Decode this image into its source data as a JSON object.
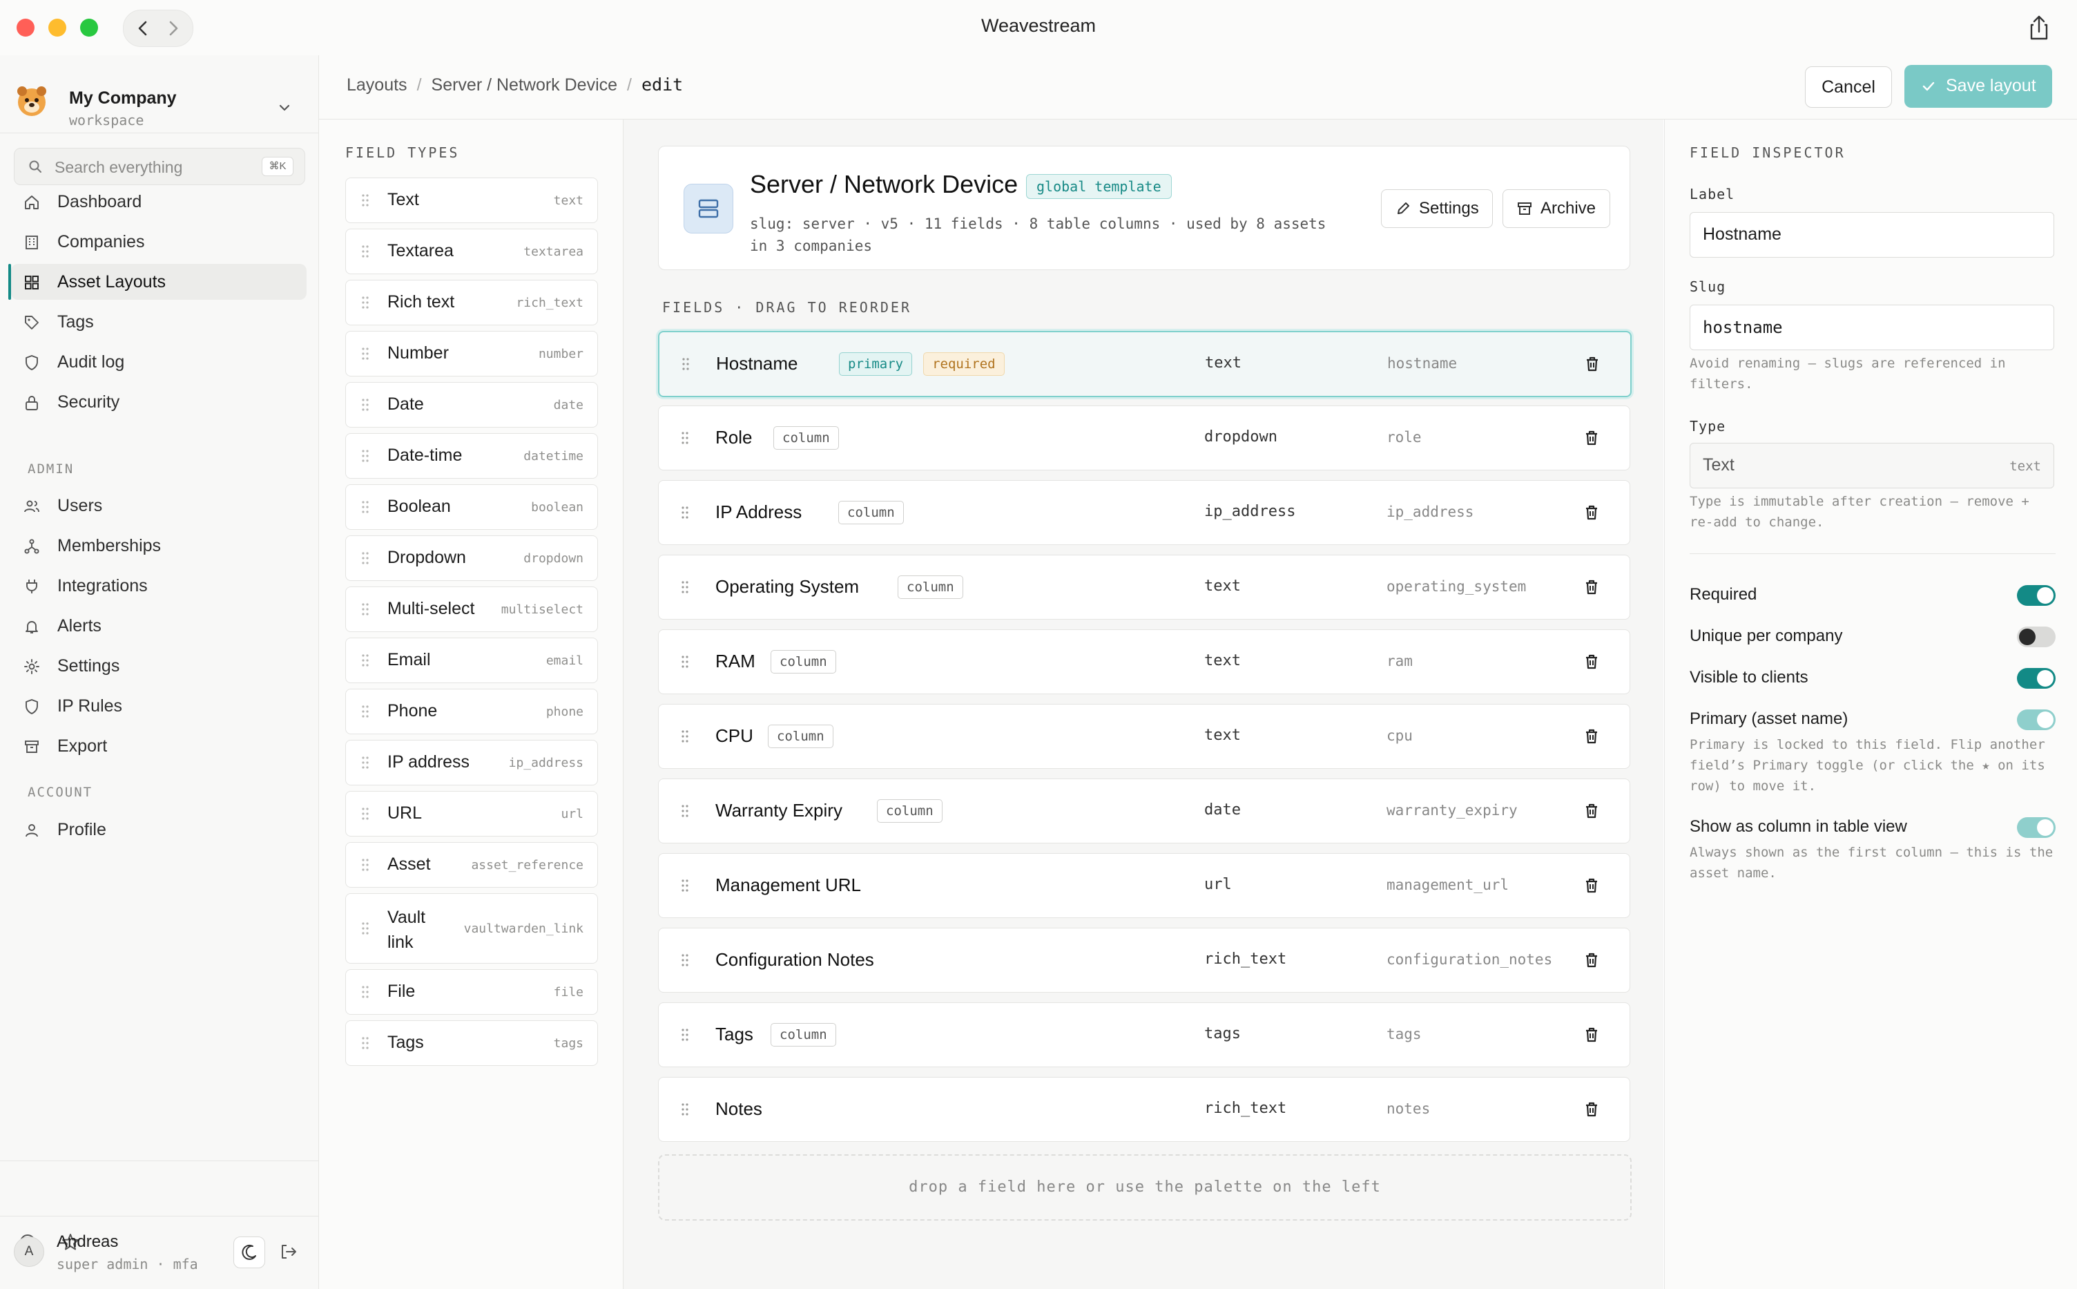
{
  "window": {
    "title": "Weavestream"
  },
  "workspace": {
    "name": "My Company",
    "type": "workspace"
  },
  "search": {
    "placeholder": "Search everything",
    "shortcut": "⌘K"
  },
  "nav": {
    "main": [
      {
        "label": "Dashboard",
        "icon": "home-icon"
      },
      {
        "label": "Companies",
        "icon": "building-icon"
      },
      {
        "label": "Asset Layouts",
        "icon": "grid-icon",
        "active": true
      },
      {
        "label": "Tags",
        "icon": "tag-icon"
      },
      {
        "label": "Audit log",
        "icon": "shield-icon"
      },
      {
        "label": "Security",
        "icon": "lock-icon"
      }
    ],
    "admin_label": "ADMIN",
    "admin": [
      {
        "label": "Users",
        "icon": "users-icon"
      },
      {
        "label": "Memberships",
        "icon": "network-icon"
      },
      {
        "label": "Integrations",
        "icon": "plug-icon"
      },
      {
        "label": "Alerts",
        "icon": "bell-icon"
      },
      {
        "label": "Settings",
        "icon": "gear-icon"
      },
      {
        "label": "IP Rules",
        "icon": "shield-icon"
      },
      {
        "label": "Export",
        "icon": "archive-icon"
      }
    ],
    "account_label": "ACCOUNT",
    "account": [
      {
        "label": "Profile",
        "icon": "user-icon"
      }
    ]
  },
  "user": {
    "name": "Andreas",
    "initial": "A",
    "role": "super admin · mfa"
  },
  "breadcrumb": {
    "items": [
      "Layouts",
      "Server / Network Device"
    ],
    "current": "edit"
  },
  "actions": {
    "cancel": "Cancel",
    "save": "Save layout"
  },
  "field_types": {
    "heading": "FIELD TYPES",
    "items": [
      {
        "label": "Text",
        "key": "text"
      },
      {
        "label": "Textarea",
        "key": "textarea"
      },
      {
        "label": "Rich text",
        "key": "rich_text"
      },
      {
        "label": "Number",
        "key": "number"
      },
      {
        "label": "Date",
        "key": "date"
      },
      {
        "label": "Date-time",
        "key": "datetime"
      },
      {
        "label": "Boolean",
        "key": "boolean"
      },
      {
        "label": "Dropdown",
        "key": "dropdown"
      },
      {
        "label": "Multi-select",
        "key": "multiselect"
      },
      {
        "label": "Email",
        "key": "email"
      },
      {
        "label": "Phone",
        "key": "phone"
      },
      {
        "label": "IP address",
        "key": "ip_address"
      },
      {
        "label": "URL",
        "key": "url"
      },
      {
        "label": "Asset",
        "key": "asset_reference"
      },
      {
        "label": "Vault link",
        "key": "vaultwarden_link"
      },
      {
        "label": "File",
        "key": "file"
      },
      {
        "label": "Tags",
        "key": "tags"
      }
    ]
  },
  "layout": {
    "title": "Server / Network Device",
    "badge": "global template",
    "meta": "slug: server · v5 · 11 fields · 8 table columns · used by 8 assets in 3 companies",
    "settings": "Settings",
    "archive": "Archive"
  },
  "fields": {
    "heading": "FIELDS · DRAG TO REORDER",
    "rows": [
      {
        "name": "Hostname",
        "tags": [
          "primary",
          "required"
        ],
        "type": "text",
        "slug": "hostname",
        "selected": true
      },
      {
        "name": "Role",
        "tags": [
          "column"
        ],
        "type": "dropdown",
        "slug": "role"
      },
      {
        "name": "IP Address",
        "tags": [
          "column"
        ],
        "type": "ip_address",
        "slug": "ip_address"
      },
      {
        "name": "Operating System",
        "tags": [
          "column"
        ],
        "type": "text",
        "slug": "operating_system"
      },
      {
        "name": "RAM",
        "tags": [
          "column"
        ],
        "type": "text",
        "slug": "ram"
      },
      {
        "name": "CPU",
        "tags": [
          "column"
        ],
        "type": "text",
        "slug": "cpu"
      },
      {
        "name": "Warranty Expiry",
        "tags": [
          "column"
        ],
        "type": "date",
        "slug": "warranty_expiry"
      },
      {
        "name": "Management URL",
        "tags": [],
        "type": "url",
        "slug": "management_url"
      },
      {
        "name": "Configuration Notes",
        "tags": [],
        "type": "rich_text",
        "slug": "configuration_notes"
      },
      {
        "name": "Tags",
        "tags": [
          "column"
        ],
        "type": "tags",
        "slug": "tags"
      },
      {
        "name": "Notes",
        "tags": [],
        "type": "rich_text",
        "slug": "notes"
      }
    ],
    "dropzone": "drop a field here or use the palette on the left"
  },
  "inspector": {
    "heading": "FIELD INSPECTOR",
    "label_label": "Label",
    "label_value": "Hostname",
    "slug_label": "Slug",
    "slug_value": "hostname",
    "slug_hint": "Avoid renaming — slugs are referenced in filters.",
    "type_label": "Type",
    "type_value": "Text",
    "type_key": "text",
    "type_hint": "Type is immutable after creation — remove + re-add to change.",
    "toggles": [
      {
        "label": "Required",
        "state": "on"
      },
      {
        "label": "Unique per company",
        "state": "off"
      },
      {
        "label": "Visible to clients",
        "state": "on"
      },
      {
        "label": "Primary (asset name)",
        "state": "on-locked",
        "hint": "Primary is locked to this field. Flip another field’s Primary toggle (or click the ★ on its row) to move it."
      },
      {
        "label": "Show as column in table view",
        "state": "on-locked",
        "hint": "Always shown as the first column — this is the asset name."
      }
    ]
  },
  "colors": {
    "accent": "#138a86",
    "save_button": "#7ac9c6",
    "primary_tag": "#178a86",
    "required_tag": "#b0731e"
  }
}
